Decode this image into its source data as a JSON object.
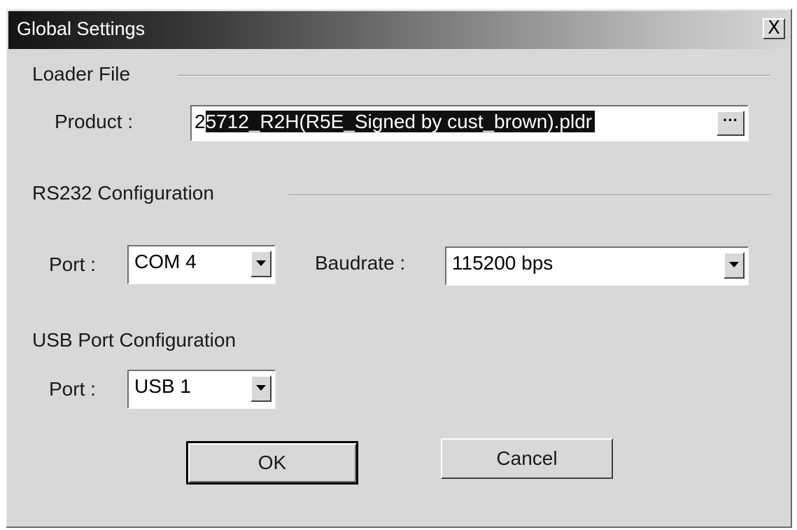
{
  "window": {
    "title": "Global Settings",
    "close_label": "X"
  },
  "loader": {
    "group_label": "Loader File",
    "product_label": "Product :",
    "product_value_first": "2",
    "product_value_selected": "5712_R2H(R5E_Signed by cust_brown).pldr",
    "browse_label": "···"
  },
  "rs232": {
    "group_label": "RS232 Configuration",
    "port_label": "Port :",
    "port_value": "COM 4",
    "baudrate_label": "Baudrate :",
    "baudrate_value": "115200 bps"
  },
  "usb": {
    "group_label": "USB Port Configuration",
    "port_label": "Port :",
    "port_value": "USB 1"
  },
  "buttons": {
    "ok_label": "OK",
    "cancel_label": "Cancel"
  }
}
